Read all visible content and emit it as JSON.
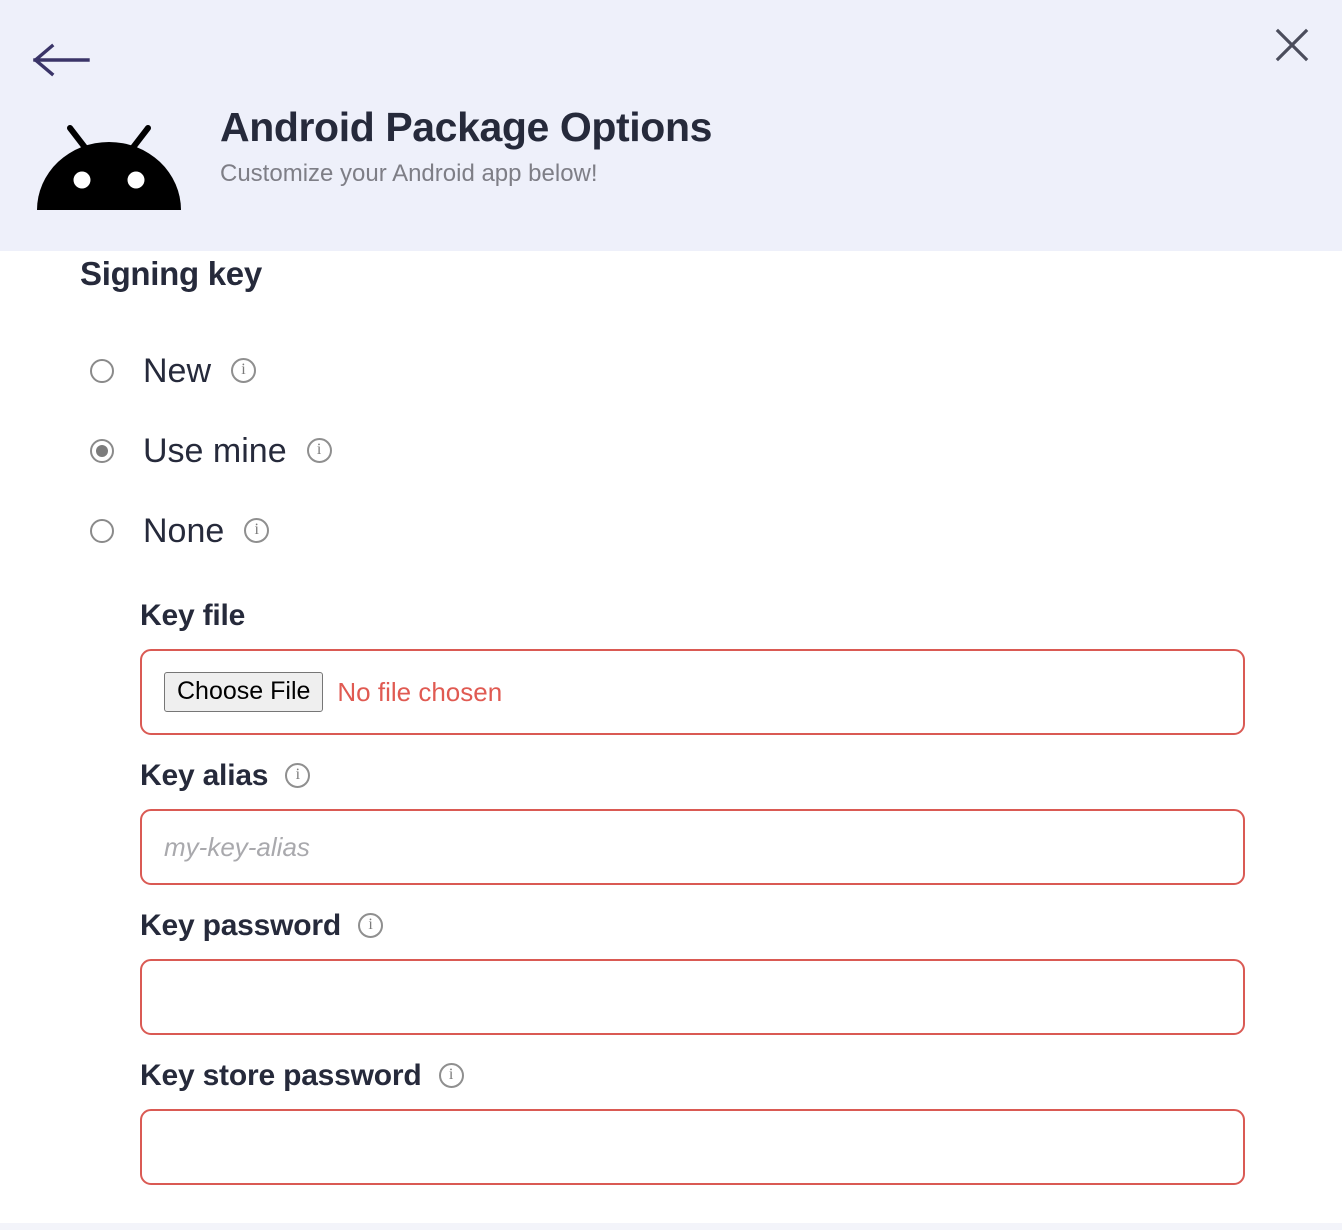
{
  "header": {
    "back_icon": "arrow-left-icon",
    "close_icon": "close-icon",
    "logo_icon": "android-robot-icon",
    "title": "Android Package Options",
    "subtitle": "Customize your Android app below!",
    "background_color": "#eef0fa",
    "back_arrow_color": "#3a3468",
    "close_color": "#4b4d5c"
  },
  "signing_key": {
    "section_title": "Signing key",
    "options": [
      {
        "label": "New",
        "selected": false,
        "info_icon": "info-icon"
      },
      {
        "label": "Use mine",
        "selected": true,
        "info_icon": "info-icon"
      },
      {
        "label": "None",
        "selected": false,
        "info_icon": "info-icon"
      }
    ]
  },
  "fields": {
    "key_file": {
      "label": "Key file",
      "button_label": "Choose File",
      "status_text": "No file chosen",
      "status_color": "#e05a52",
      "border_color": "#da5a54"
    },
    "key_alias": {
      "label": "Key alias",
      "placeholder": "my-key-alias",
      "value": "",
      "info_icon": "info-icon"
    },
    "key_password": {
      "label": "Key password",
      "placeholder": "",
      "value": "",
      "info_icon": "info-icon"
    },
    "key_store_password": {
      "label": "Key store password",
      "placeholder": "",
      "value": "",
      "info_icon": "info-icon"
    }
  },
  "icons": {
    "info_glyph": "i"
  }
}
